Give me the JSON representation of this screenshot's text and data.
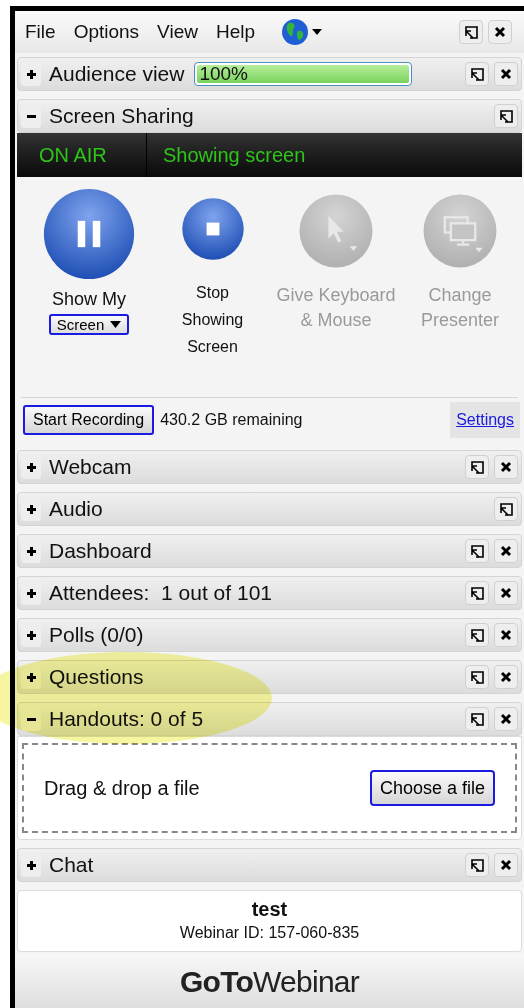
{
  "menu": [
    "File",
    "Options",
    "View",
    "Help"
  ],
  "panels": [
    {
      "kind": "meter",
      "title": "Audience view",
      "expanded": false,
      "closable": true,
      "reading": "100%",
      "level": 1
    },
    {
      "kind": "screen_sharing",
      "title": "Screen Sharing",
      "expanded": true,
      "closable": false,
      "status": "ON AIR",
      "status_text": "Showing screen",
      "actions": [
        {
          "kind": "pause",
          "label": "Show My",
          "dropdown": "Screen",
          "enabled": true
        },
        {
          "kind": "stop",
          "label": "Stop Showing Screen",
          "enabled": true
        },
        {
          "kind": "pointer",
          "label": "Give Keyboard & Mouse",
          "enabled": false
        },
        {
          "kind": "presenter",
          "label": "Change Presenter",
          "enabled": false
        }
      ],
      "record_button": "Start Recording",
      "remaining": "430.2 GB remaining",
      "settings_link": "Settings"
    },
    {
      "kind": "plain",
      "title": "Webcam",
      "expanded": false,
      "closable": true
    },
    {
      "kind": "plain",
      "title": "Audio",
      "expanded": false,
      "closable": false
    },
    {
      "kind": "plain",
      "title": "Dashboard",
      "expanded": false,
      "closable": true
    },
    {
      "kind": "plain",
      "title": "Attendees:  1 out of 101",
      "expanded": false,
      "closable": true
    },
    {
      "kind": "plain",
      "title": "Polls (0/0)",
      "expanded": false,
      "closable": true
    },
    {
      "kind": "plain",
      "title": "Questions",
      "expanded": false,
      "closable": true
    },
    {
      "kind": "handouts",
      "title": "Handouts: 0 of 5",
      "expanded": true,
      "closable": true,
      "drop_text": "Drag & drop a file",
      "choose_button": "Choose a file"
    },
    {
      "kind": "plain",
      "title": "Chat",
      "expanded": false,
      "closable": true
    }
  ],
  "session": {
    "name": "test",
    "webinar_id": "Webinar ID: 157-060-835"
  },
  "logo": "**GoTo**Webinar"
}
